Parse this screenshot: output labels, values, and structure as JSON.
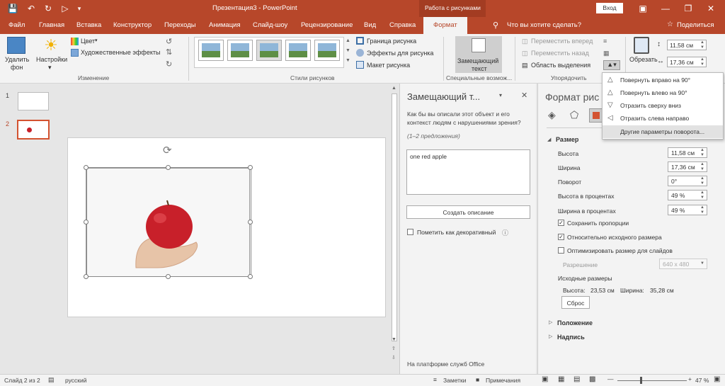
{
  "titlebar": {
    "title": "Презентация3 - PowerPoint",
    "context_tab": "Работа с рисунками",
    "login": "Вход"
  },
  "tabs": [
    "Файл",
    "Главная",
    "Вставка",
    "Конструктор",
    "Переходы",
    "Анимация",
    "Слайд-шоу",
    "Рецензирование",
    "Вид",
    "Справка"
  ],
  "active_tab": "Формат",
  "tell_me": "Что вы хотите сделать?",
  "share": "Поделиться",
  "ribbon": {
    "remove_bg": "Удалить",
    "remove_bg2": "фон",
    "corrections": "Настройки",
    "color": "Цвет",
    "artistic": "Художественные эффекты",
    "group_change": "Изменение",
    "border": "Граница рисунка",
    "effects": "Эффекты для рисунка",
    "layout": "Макет рисунка",
    "group_styles": "Стили рисунков",
    "alt_text": "Замещающий",
    "alt_text2": "текст",
    "group_access": "Специальные возмож...",
    "bring_forward": "Переместить вперед",
    "send_backward": "Переместить назад",
    "selection_pane": "Область выделения",
    "group_arrange": "Упорядочить",
    "crop": "Обрезать",
    "height": "11,58 см",
    "width": "17,36 см"
  },
  "rotate_menu": [
    "Повернуть вправо на 90°",
    "Повернуть влево на 90°",
    "Отразить сверху вниз",
    "Отразить слева направо",
    "Другие параметры поворота..."
  ],
  "thumbs": [
    "1",
    "2"
  ],
  "alt_pane": {
    "title": "Замещающий т...",
    "question": "Как бы вы описали этот объект и его контекст людям с нарушениями зрения?",
    "hint": "(1–2 предложения)",
    "text": "one red apple",
    "generate": "Создать описание",
    "decorative": "Пометить как декоративный",
    "footer": "На платформе служб Office"
  },
  "fmt_pane": {
    "title": "Формат рис",
    "size_section": "Размер",
    "height_label": "Высота",
    "height_val": "11,58 см",
    "width_label": "Ширина",
    "width_val": "17,36 см",
    "rotation_label": "Поворот",
    "rotation_val": "0°",
    "scale_h_label": "Высота в процентах",
    "scale_h_val": "49 %",
    "scale_w_label": "Ширина в процентах",
    "scale_w_val": "49 %",
    "lock_aspect": "Сохранить пропорции",
    "relative": "Относительно исходного размера",
    "optimize": "Оптимизировать размер для слайдов",
    "resolution_label": "Разрешение",
    "resolution_val": "640 x 480",
    "orig_size": "Исходные размеры",
    "orig_h_label": "Высота:",
    "orig_h_val": "23,53 см",
    "orig_w_label": "Ширина:",
    "orig_w_val": "35,28 см",
    "reset": "Сброс",
    "position": "Положение",
    "caption": "Надпись"
  },
  "status": {
    "slide": "Слайд 2 из 2",
    "lang": "русский",
    "notes": "Заметки",
    "comments": "Примечания",
    "zoom": "47 %"
  },
  "colors": {
    "accent": "#b7472a",
    "ribbon": "#f3f3f3",
    "apple": "#c8202a"
  }
}
